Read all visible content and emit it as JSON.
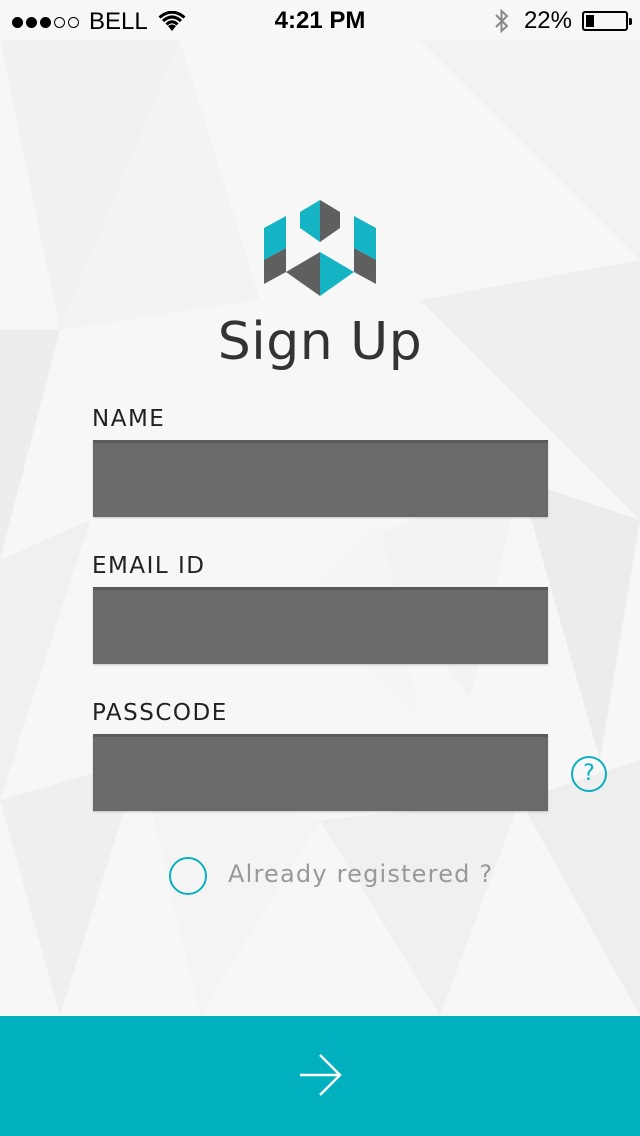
{
  "status_bar": {
    "signal": {
      "filled": 3,
      "total": 5
    },
    "carrier": "BELL",
    "time": "4:21 PM",
    "battery_percent_label": "22%",
    "battery_level": 0.22
  },
  "header": {
    "title": "Sign Up"
  },
  "form": {
    "name_label": "NAME",
    "name_value": "",
    "email_label": "EMAIL ID",
    "email_value": "",
    "passcode_label": "PASSCODE",
    "passcode_value": "",
    "help_symbol": "?"
  },
  "already_registered": {
    "label": "Already registered ?",
    "checked": false
  },
  "footer": {
    "submit_icon": "arrow-right-icon"
  },
  "colors": {
    "accent": "#00b0bf",
    "logo_teal": "#14b4c4",
    "logo_gray": "#5f5f5f",
    "input_bg": "#6a6a6a",
    "title_text": "#333333"
  }
}
